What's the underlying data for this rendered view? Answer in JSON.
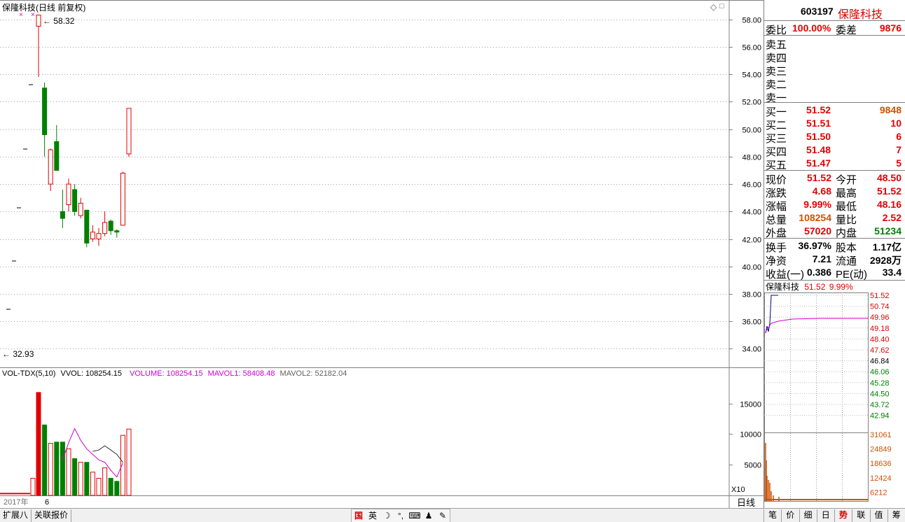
{
  "chart_header": {
    "title": "保隆科技(日线 前复权)",
    "max_label": "58.32",
    "min_label": "32.93",
    "price_ticks": [
      "58.00",
      "56.00",
      "54.00",
      "52.00",
      "50.00",
      "48.00",
      "46.00",
      "44.00",
      "42.00",
      "40.00",
      "38.00",
      "36.00",
      "34.00"
    ],
    "diamond_icons": [
      "◇",
      "□"
    ]
  },
  "volume_header": {
    "name": "VOL-TDX(5,10)",
    "vvol": "VVOL: 108254.15",
    "volume": "VOLUME: 108254.15",
    "mavol1": "MAVOL1: 58408.48",
    "mavol2": "MAVOL2: 52182.04",
    "ticks": [
      "15000",
      "10000",
      "5000"
    ],
    "unit": "X10"
  },
  "time_axis": {
    "year": "2017年",
    "month": "6",
    "period": "日线"
  },
  "chart_data": {
    "type": "candlestick",
    "price_ylim": [
      33.0,
      58.6
    ],
    "vol_ylim": [
      0,
      18500
    ],
    "candles": [
      {
        "o": 57.5,
        "h": 58.32,
        "l": 53.8,
        "c": 58.32,
        "v": 16800,
        "up": true
      },
      {
        "o": 53.0,
        "h": 53.4,
        "l": 48.0,
        "c": 49.6,
        "v": 11500,
        "up": false
      },
      {
        "o": 46.0,
        "h": 48.6,
        "l": 45.5,
        "c": 48.5,
        "v": 8500,
        "up": true
      },
      {
        "o": 49.1,
        "h": 50.3,
        "l": 47.0,
        "c": 47.0,
        "v": 8700,
        "up": false
      },
      {
        "o": 44.0,
        "h": 45.6,
        "l": 42.8,
        "c": 43.5,
        "v": 8700,
        "up": false
      },
      {
        "o": 44.5,
        "h": 46.4,
        "l": 44.0,
        "c": 46.0,
        "v": 7600,
        "up": true
      },
      {
        "o": 45.6,
        "h": 46.0,
        "l": 43.7,
        "c": 44.0,
        "v": 6000,
        "up": false
      },
      {
        "o": 43.7,
        "h": 45.0,
        "l": 43.5,
        "c": 44.6,
        "v": 5400,
        "up": true
      },
      {
        "o": 44.1,
        "h": 44.1,
        "l": 41.4,
        "c": 41.7,
        "v": 5400,
        "up": false
      },
      {
        "o": 42.0,
        "h": 43.0,
        "l": 41.8,
        "c": 42.5,
        "v": 3800,
        "up": true
      },
      {
        "o": 42.0,
        "h": 42.8,
        "l": 41.5,
        "c": 42.4,
        "v": 2800,
        "up": true
      },
      {
        "o": 42.4,
        "h": 44.0,
        "l": 42.2,
        "c": 43.2,
        "v": 4500,
        "up": true
      },
      {
        "o": 43.3,
        "h": 43.4,
        "l": 42.3,
        "c": 42.6,
        "v": 2800,
        "up": false
      },
      {
        "o": 42.6,
        "h": 42.7,
        "l": 42.1,
        "c": 42.5,
        "v": 2300,
        "up": false
      },
      {
        "o": 43.0,
        "h": 46.9,
        "l": 43.0,
        "c": 46.8,
        "v": 9800,
        "up": true
      },
      {
        "o": 48.2,
        "h": 51.52,
        "l": 48.0,
        "c": 51.52,
        "v": 10825,
        "up": true
      }
    ],
    "ma1": [
      null,
      null,
      null,
      null,
      5800,
      8600,
      10900,
      9000,
      7600,
      6700,
      5800,
      5400,
      4100,
      3000,
      5300
    ],
    "ma2": [
      null,
      null,
      null,
      null,
      null,
      null,
      null,
      null,
      null,
      7200,
      7400,
      8100,
      7400,
      6700,
      5400
    ],
    "prev_bars_vol": 300
  },
  "quote": {
    "code": "603197",
    "name": "保隆科技",
    "weibi_label": "委比",
    "weibi": "100.00%",
    "weicha_label": "委差",
    "weicha": "9876",
    "sells": [
      {
        "label": "卖五",
        "price": "",
        "vol": ""
      },
      {
        "label": "卖四",
        "price": "",
        "vol": ""
      },
      {
        "label": "卖三",
        "price": "",
        "vol": ""
      },
      {
        "label": "卖二",
        "price": "",
        "vol": ""
      },
      {
        "label": "卖一",
        "price": "",
        "vol": ""
      }
    ],
    "buys": [
      {
        "label": "买一",
        "price": "51.52",
        "vol": "9848"
      },
      {
        "label": "买二",
        "price": "51.51",
        "vol": "10"
      },
      {
        "label": "买三",
        "price": "51.50",
        "vol": "6"
      },
      {
        "label": "买四",
        "price": "51.48",
        "vol": "7"
      },
      {
        "label": "买五",
        "price": "51.47",
        "vol": "5"
      }
    ],
    "stats": [
      {
        "l1": "现价",
        "v1": "51.52",
        "c1": "red",
        "l2": "今开",
        "v2": "48.50",
        "c2": "red"
      },
      {
        "l1": "涨跌",
        "v1": "4.68",
        "c1": "red",
        "l2": "最高",
        "v2": "51.52",
        "c2": "red"
      },
      {
        "l1": "涨幅",
        "v1": "9.99%",
        "c1": "red",
        "l2": "最低",
        "v2": "48.16",
        "c2": "red"
      },
      {
        "l1": "总量",
        "v1": "108254",
        "c1": "orange",
        "l2": "量比",
        "v2": "2.52",
        "c2": "red"
      },
      {
        "l1": "外盘",
        "v1": "57020",
        "c1": "red",
        "l2": "内盘",
        "v2": "51234",
        "c2": "green"
      }
    ],
    "fundamentals": [
      {
        "l1": "换手",
        "v1": "36.97%",
        "l2": "股本",
        "v2": "1.17亿"
      },
      {
        "l1": "净资",
        "v1": "7.21",
        "l2": "流通",
        "v2": "2928万"
      },
      {
        "l1": "收益(一)",
        "v1": "0.386",
        "l2": "PE(动)",
        "v2": "33.4"
      }
    ]
  },
  "mini_chart": {
    "name": "保隆科技",
    "price": "51.52",
    "pct": "9.99%",
    "price_ticks": [
      "51.52",
      "50.74",
      "49.96",
      "49.18",
      "48.40",
      "47.62",
      "46.84",
      "46.06",
      "45.28",
      "44.50",
      "43.72",
      "42.94"
    ],
    "vol_ticks": [
      "31061",
      "24849",
      "18636",
      "12424",
      "6212"
    ]
  },
  "bottom": {
    "tabs": [
      "扩展八",
      "关联报价"
    ],
    "ime": [
      "国",
      "英",
      "☽",
      "°,",
      "⌨",
      "♟",
      "✎"
    ],
    "right_tabs": [
      "笔",
      "价",
      "细",
      "日",
      "势",
      "联",
      "值",
      "筹"
    ],
    "active_right_tab": "势"
  },
  "colors": {
    "up": "#e00000",
    "down": "#008000",
    "ma1": "#d000d0",
    "ma2": "#303030",
    "grid": "#a0a0a0"
  }
}
